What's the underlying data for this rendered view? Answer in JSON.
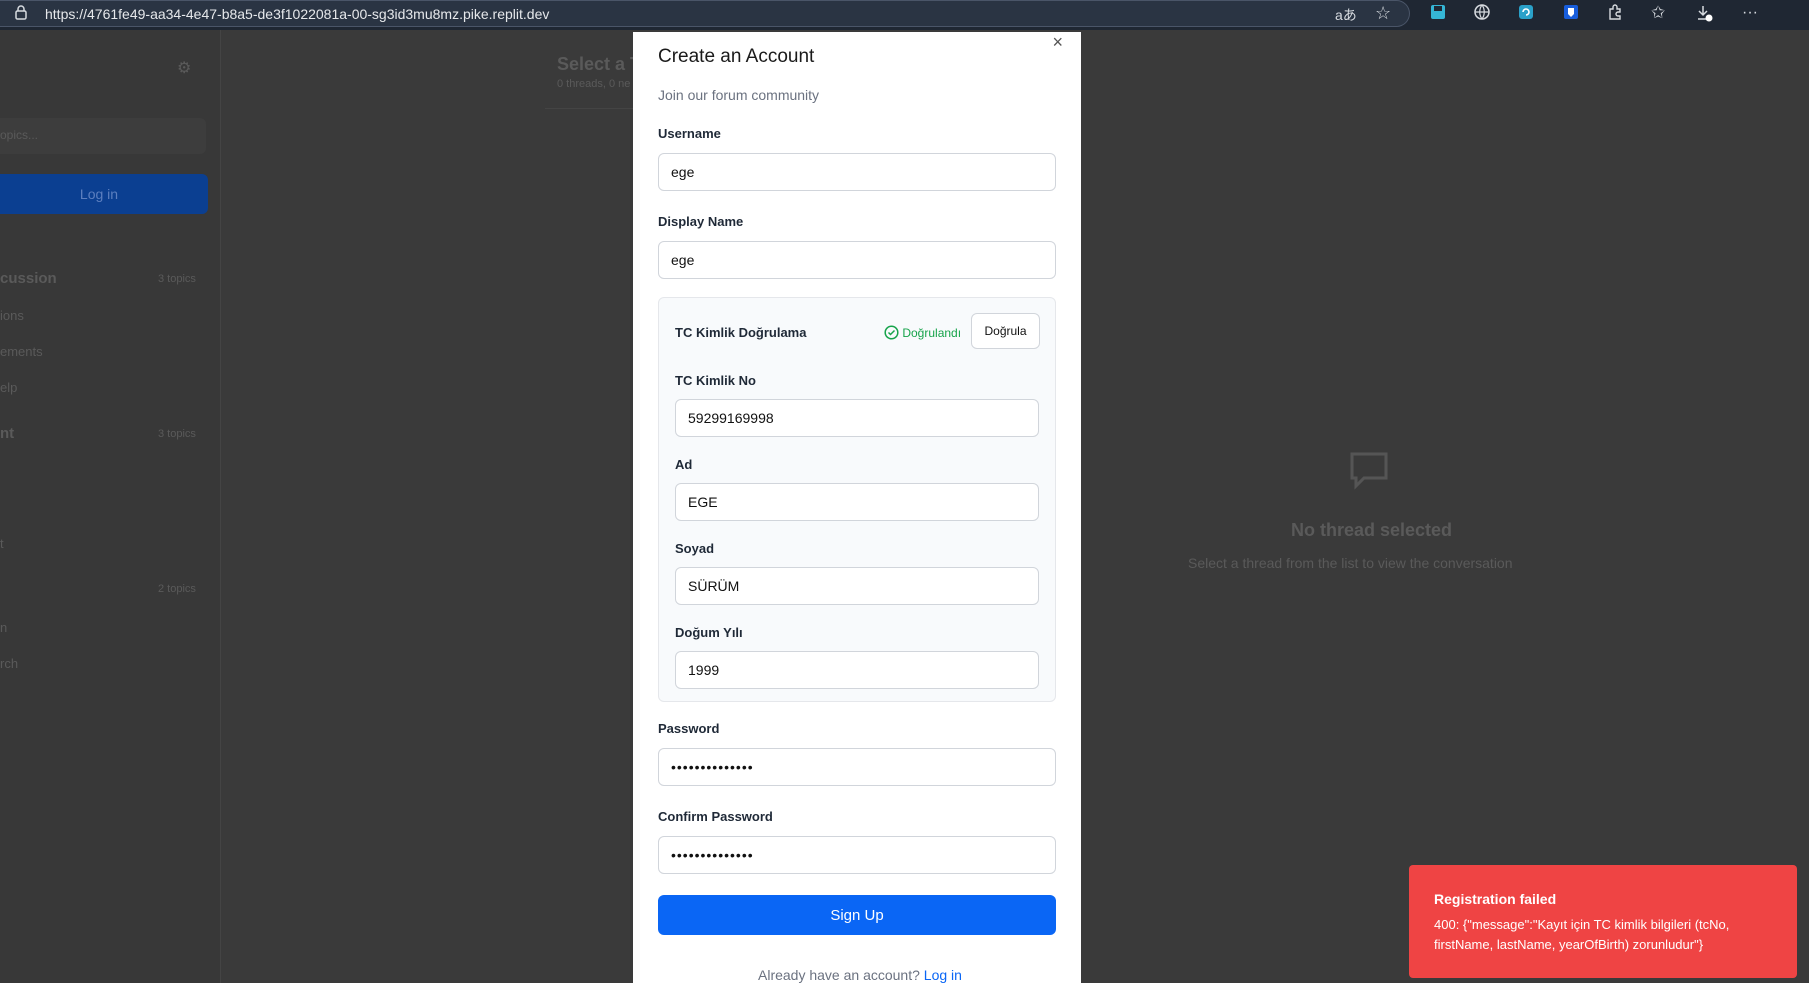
{
  "browser": {
    "url": "https://4761fe49-aa34-4e47-b8a5-de3f1022081a-00-sg3id3mu8mz.pike.replit.dev"
  },
  "sidebar": {
    "search_placeholder": "opics...",
    "login_label": "Log in",
    "categories": [
      {
        "name": "cussion",
        "count": "3 topics",
        "items": [
          "ions",
          "ements",
          "elp"
        ]
      },
      {
        "name": "nt",
        "count": "3 topics",
        "items": [
          "t"
        ]
      },
      {
        "name": "",
        "count": "2 topics",
        "items": [
          "n",
          "rch"
        ]
      }
    ]
  },
  "threads": {
    "title": "Select a T",
    "meta": "0 threads, 0 ne"
  },
  "empty_state": {
    "title": "No thread selected",
    "subtitle": "Select a thread from the list to view the conversation"
  },
  "modal": {
    "title": "Create an Account",
    "subtitle": "Join our forum community",
    "username_label": "Username",
    "username_value": "ege",
    "display_name_label": "Display Name",
    "display_name_value": "ege",
    "tc_section_title": "TC Kimlik Doğrulama",
    "verified_text": "Doğrulandı",
    "verify_button": "Doğrula",
    "tc_no_label": "TC Kimlik No",
    "tc_no_value": "59299169998",
    "first_name_label": "Ad",
    "first_name_value": "EGE",
    "last_name_label": "Soyad",
    "last_name_value": "SÜRÜM",
    "birth_year_label": "Doğum Yılı",
    "birth_year_value": "1999",
    "password_label": "Password",
    "password_value": "••••••••••••••",
    "confirm_password_label": "Confirm Password",
    "confirm_password_value": "••••••••••••••",
    "signup_button": "Sign Up",
    "already_text": "Already have an account?",
    "login_link": "Log in"
  },
  "toast": {
    "title": "Registration failed",
    "message": "400: {\"message\":\"Kayıt için TC kimlik bilgileri (tcNo, firstName, lastName, yearOfBirth) zorunludur\"}"
  },
  "colors": {
    "primary": "#0a66f5",
    "success": "#16a34a",
    "error": "#ef4444"
  }
}
